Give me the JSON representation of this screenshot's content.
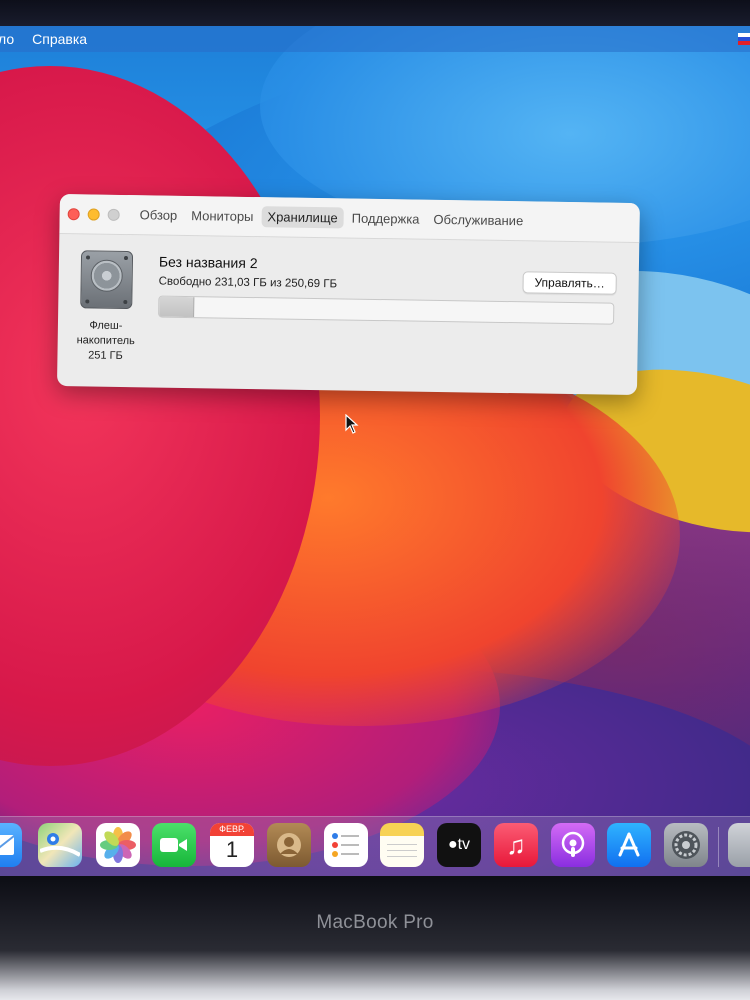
{
  "menubar": {
    "items": [
      "ло",
      "Справка"
    ]
  },
  "about_window": {
    "tabs": [
      "Обзор",
      "Мониторы",
      "Хранилище",
      "Поддержка",
      "Обслуживание"
    ],
    "active_tab": "Хранилище",
    "disk": {
      "caption_line1": "Флеш-",
      "caption_line2": "накопитель",
      "caption_line3": "251 ГБ"
    },
    "volume": {
      "name": "Без названия 2",
      "free_text": "Свободно 231,03 ГБ из 250,69 ГБ",
      "used_fraction": 0.078
    },
    "manage_button": "Управлять…"
  },
  "dock": {
    "calendar_month": "ФЕВР.",
    "calendar_day": "1",
    "tv_label": "tv",
    "apps": [
      "mail-icon",
      "maps-icon",
      "photos-icon",
      "facetime-icon",
      "calendar-icon",
      "contacts-icon",
      "reminders-icon",
      "notes-icon",
      "tv-icon",
      "music-icon",
      "podcasts-icon",
      "app-store-icon",
      "system-preferences-icon"
    ]
  },
  "device": {
    "model": "MacBook Pro"
  },
  "colors": {
    "close": "#fe5f57",
    "minimize": "#febc2e",
    "window_bg": "#ececec"
  }
}
